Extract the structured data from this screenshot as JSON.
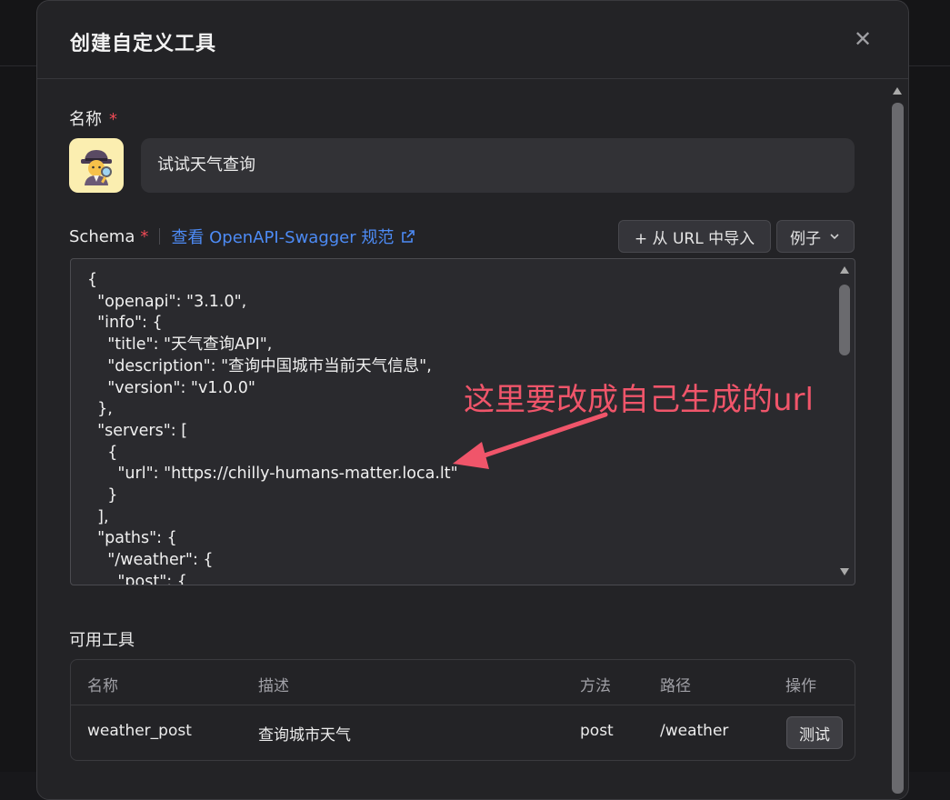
{
  "dialog": {
    "title": "创建自定义工具",
    "close_icon": "close-icon"
  },
  "name_field": {
    "label": "名称",
    "required_mark": "*",
    "value": "试试天气查询",
    "avatar_icon": "detective-emoji-icon"
  },
  "schema": {
    "label": "Schema",
    "required_mark": "*",
    "link_text": "查看 OpenAPI-Swagger 规范",
    "link_icon": "external-link-icon",
    "import_button": "+ 从 URL 中导入",
    "examples_button": "例子",
    "code_lines": [
      "{",
      "  \"openapi\": \"3.1.0\",",
      "  \"info\": {",
      "    \"title\": \"天气查询API\",",
      "    \"description\": \"查询中国城市当前天气信息\",",
      "    \"version\": \"v1.0.0\"",
      "  },",
      "  \"servers\": [",
      "    {",
      "      \"url\": \"https://chilly-humans-matter.loca.lt\"",
      "    }",
      "  ],",
      "  \"paths\": {",
      "    \"/weather\": {",
      "      \"post\": {"
    ]
  },
  "annotation": {
    "text": "这里要改成自己生成的url",
    "color": "#f0556a"
  },
  "tools": {
    "label": "可用工具",
    "columns": [
      "名称",
      "描述",
      "方法",
      "路径",
      "操作"
    ],
    "rows": [
      {
        "name": "weather_post",
        "description": "查询城市天气",
        "method": "post",
        "path": "/weather",
        "action": "测试"
      }
    ]
  },
  "colors": {
    "accent_link": "#4d8bf5",
    "required": "#ef4a56",
    "background": "#232326"
  }
}
